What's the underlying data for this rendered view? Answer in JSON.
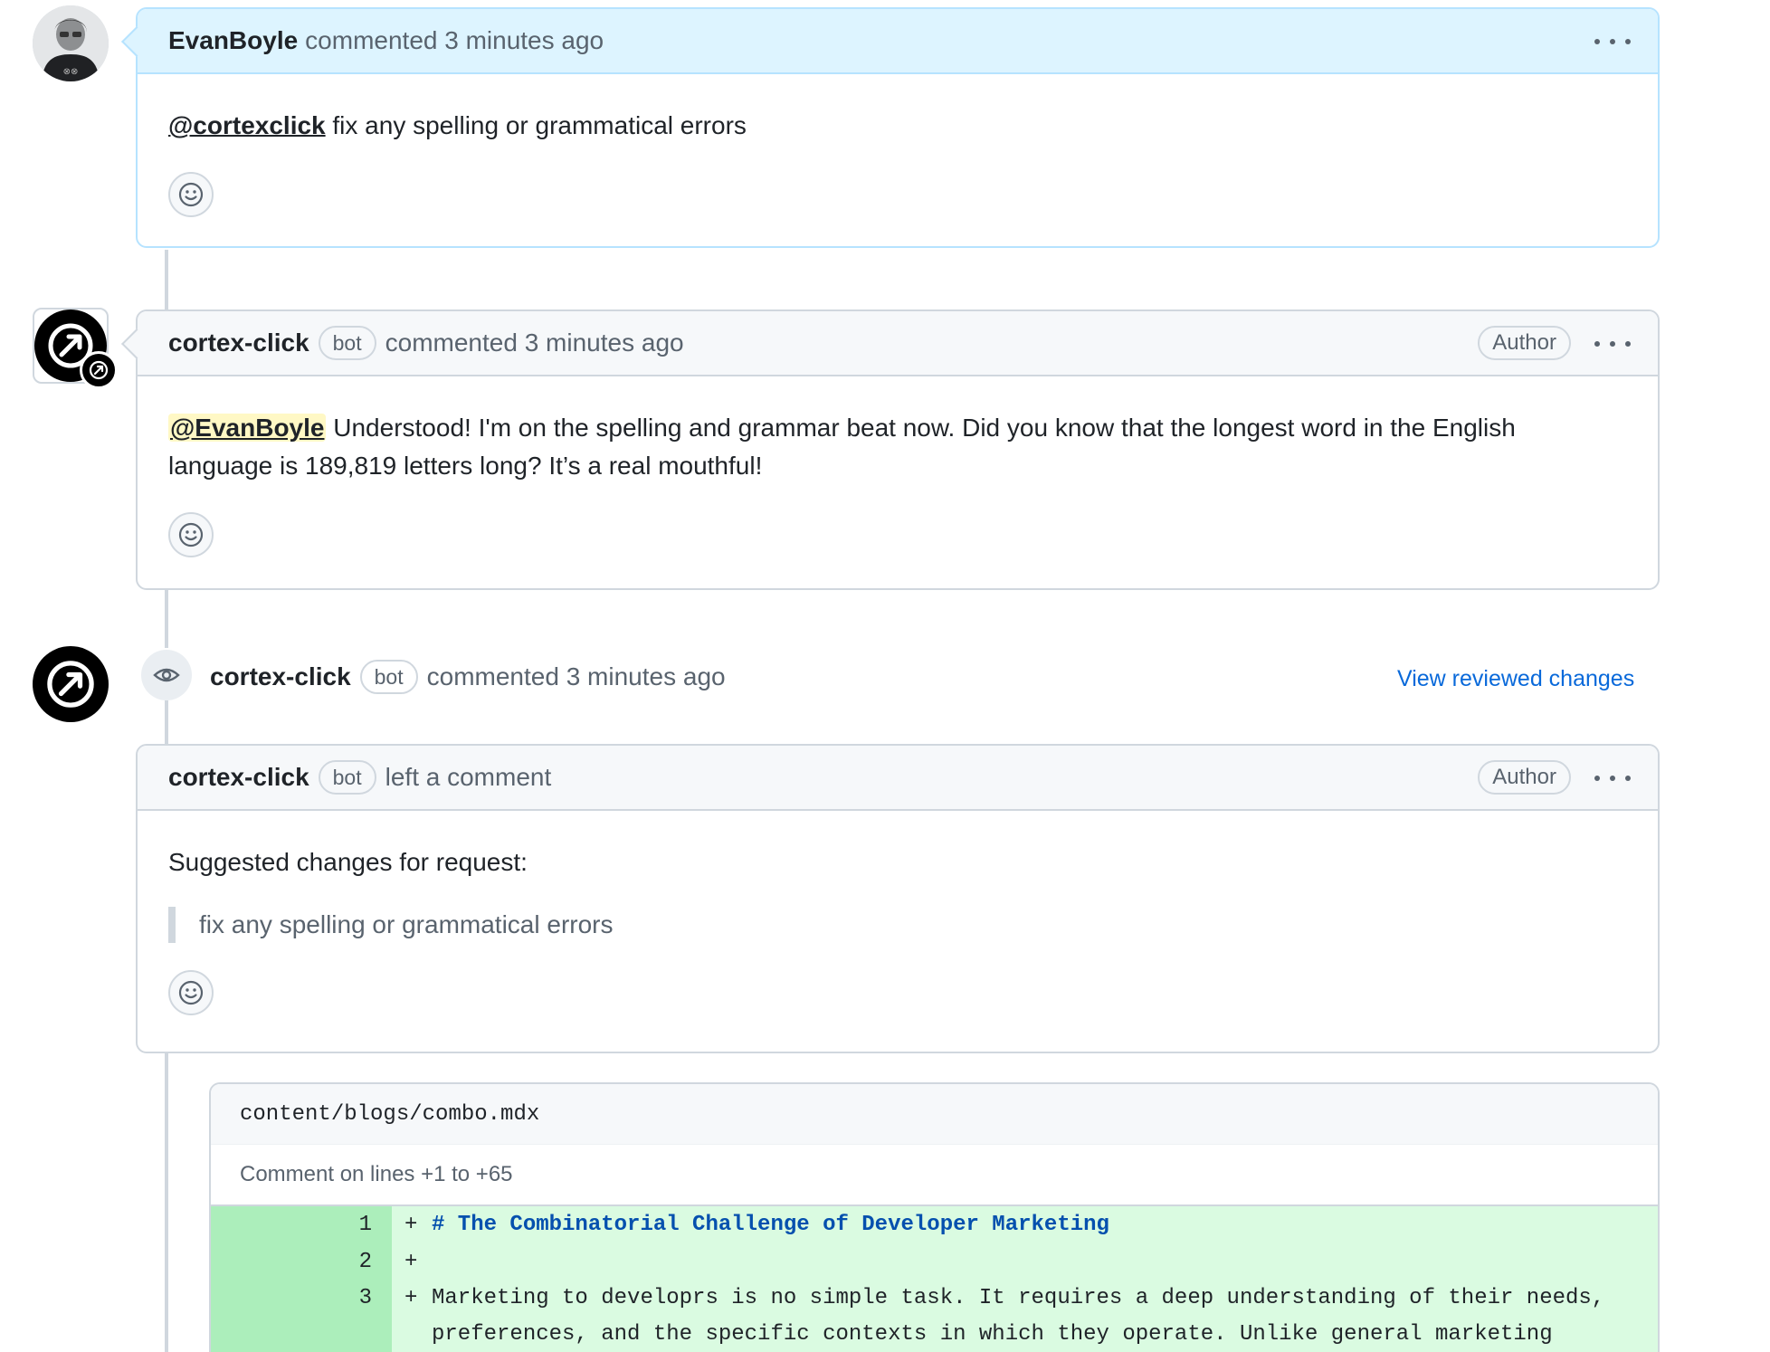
{
  "comment1": {
    "author": "EvanBoyle",
    "meta": "commented 3 minutes ago",
    "mention": "@cortexclick",
    "body": " fix any spelling or grammatical errors"
  },
  "comment2": {
    "author": "cortex-click",
    "bot_badge": "bot",
    "meta": "commented 3 minutes ago",
    "role_badge": "Author",
    "mention": "@EvanBoyle",
    "body_line1": " Understood! I'm on the spelling and grammar beat now. Did you know that the longest word in the English",
    "body_line2": "language is 189,819 letters long? It’s a real mouthful!"
  },
  "review": {
    "author": "cortex-click",
    "bot_badge": "bot",
    "meta": "commented 3 minutes ago",
    "view_link": "View reviewed changes",
    "inner_author": "cortex-click",
    "inner_bot_badge": "bot",
    "inner_meta": "left a comment",
    "role_badge": "Author",
    "body": "Suggested changes for request:",
    "quote": "fix any spelling or grammatical errors"
  },
  "diff": {
    "file": "content/blogs/combo.mdx",
    "note": "Comment on lines +1 to +65",
    "lines": [
      {
        "num": "1",
        "sign": "+",
        "text": "# The Combinatorial Challenge of Developer Marketing"
      },
      {
        "num": "2",
        "sign": "+",
        "text": ""
      },
      {
        "num": "3",
        "sign": "+",
        "text": "Marketing to developrs is no simple task. It requires a deep understanding of their needs,"
      },
      {
        "num": "",
        "sign": "",
        "text": "preferences, and the specific contexts in which they operate. Unlike general marketing"
      }
    ]
  },
  "icons": {
    "kebab": "kebab-horizontal-icon",
    "emoji": "smiley-icon",
    "eye": "eye-icon",
    "bot_logo": "cortex-arrow-logo"
  },
  "colors": {
    "link": "#0969da",
    "highlight_header": "#ddf4ff",
    "diff_add": "#dafbe1",
    "mention_bg": "#fff8c5"
  }
}
